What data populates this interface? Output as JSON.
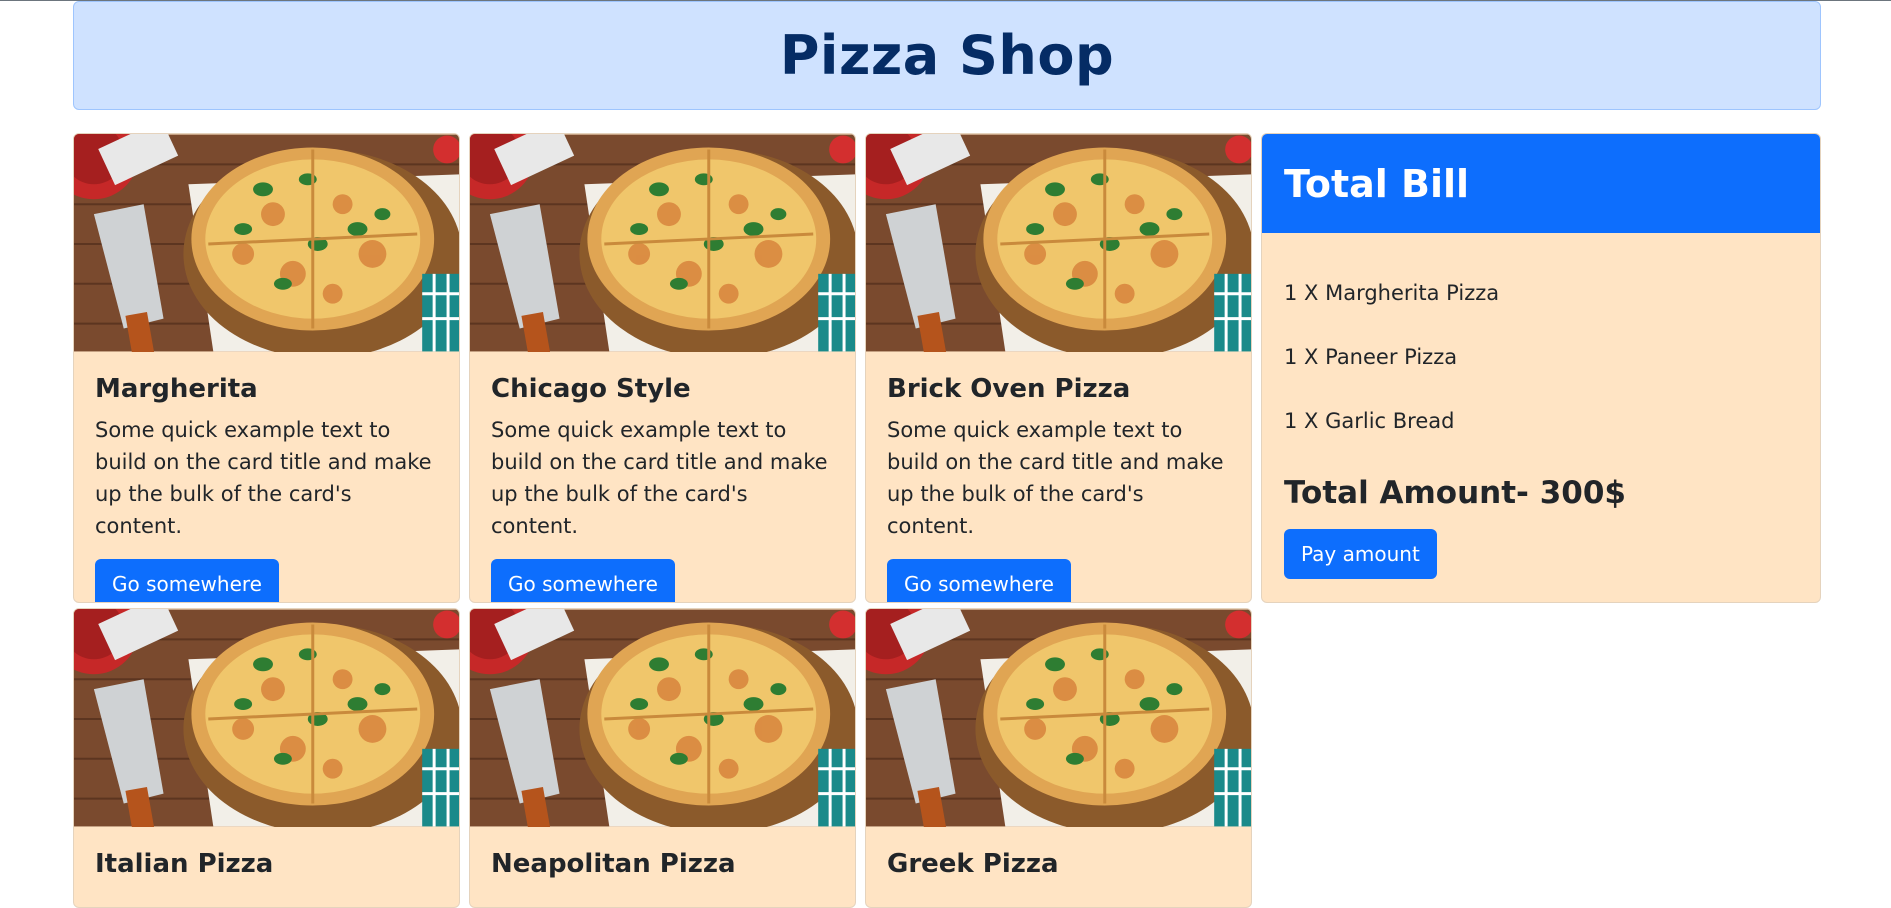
{
  "page_title": "Pizza Shop",
  "cards": [
    {
      "title": "Margherita",
      "text": "Some quick example text to build on the card title and make up the bulk of the card's content.",
      "button": "Go somewhere"
    },
    {
      "title": "Chicago Style",
      "text": "Some quick example text to build on the card title and make up the bulk of the card's content.",
      "button": "Go somewhere"
    },
    {
      "title": "Brick Oven Pizza",
      "text": "Some quick example text to build on the card title and make up the bulk of the card's content.",
      "button": "Go somewhere"
    },
    {
      "title": "Italian Pizza"
    },
    {
      "title": "Neapolitan Pizza"
    },
    {
      "title": "Greek Pizza"
    }
  ],
  "bill": {
    "title": "Total Bill",
    "items": [
      "1 X Margherita Pizza",
      "1 X Paneer Pizza",
      "1 X Garlic Bread"
    ],
    "total": "Total Amount- 300$",
    "pay_button": "Pay amount"
  },
  "colors": {
    "header_bg": "#cfe2ff",
    "header_text": "#052c65",
    "card_bg": "#ffe4c4",
    "primary": "#0d6efd"
  }
}
